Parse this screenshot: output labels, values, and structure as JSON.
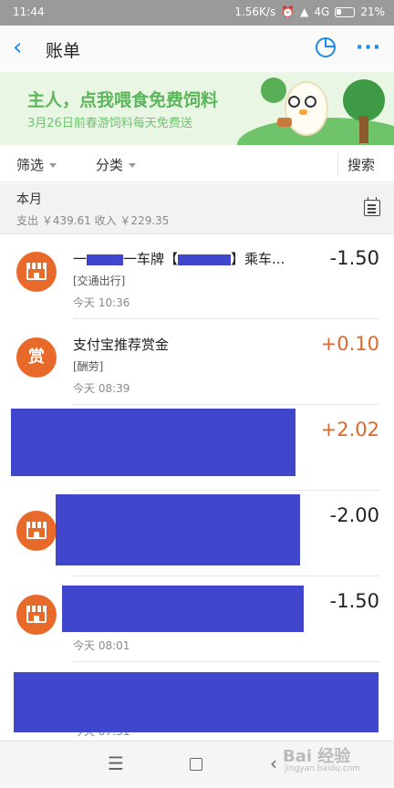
{
  "status_bar": {
    "time": "11:44",
    "speed": "1.56K/s",
    "network": "4G",
    "battery": "21%"
  },
  "header": {
    "title": "账单"
  },
  "banner": {
    "headline": "主人，点我喂食免费饲料",
    "subline": "3月26日前春游饲料每天免费送"
  },
  "filters": {
    "filter_label": "筛选",
    "category_label": "分类",
    "search_label": "搜索"
  },
  "month": {
    "title": "本月",
    "summary": "支出 ￥439.61   收入 ￥229.35"
  },
  "records": [
    {
      "title_left": "一",
      "title_mid": "一车牌【",
      "title_right": "】乘车...",
      "category": "[交通出行]",
      "time": "今天   10:36",
      "amount": "-1.50"
    },
    {
      "title": "支付宝推荐赏金",
      "category": "[酬劳]",
      "time": "今天   08:39",
      "amount": "+0.10",
      "icon_text": "赏"
    },
    {
      "amount": "+2.02"
    },
    {
      "amount": "-2.00"
    },
    {
      "time": "今天   08:01",
      "amount": "-1.50"
    },
    {
      "time": "今天   07:31"
    }
  ],
  "watermark": {
    "text": "Bai 经验",
    "sub": "jingyan.baidu.com"
  },
  "colors": {
    "accent": "#1e88e5",
    "income": "#e0672a",
    "icon_bg": "#e86a2a",
    "redaction": "#4047cd",
    "banner_bg": "#e9f6e4"
  }
}
